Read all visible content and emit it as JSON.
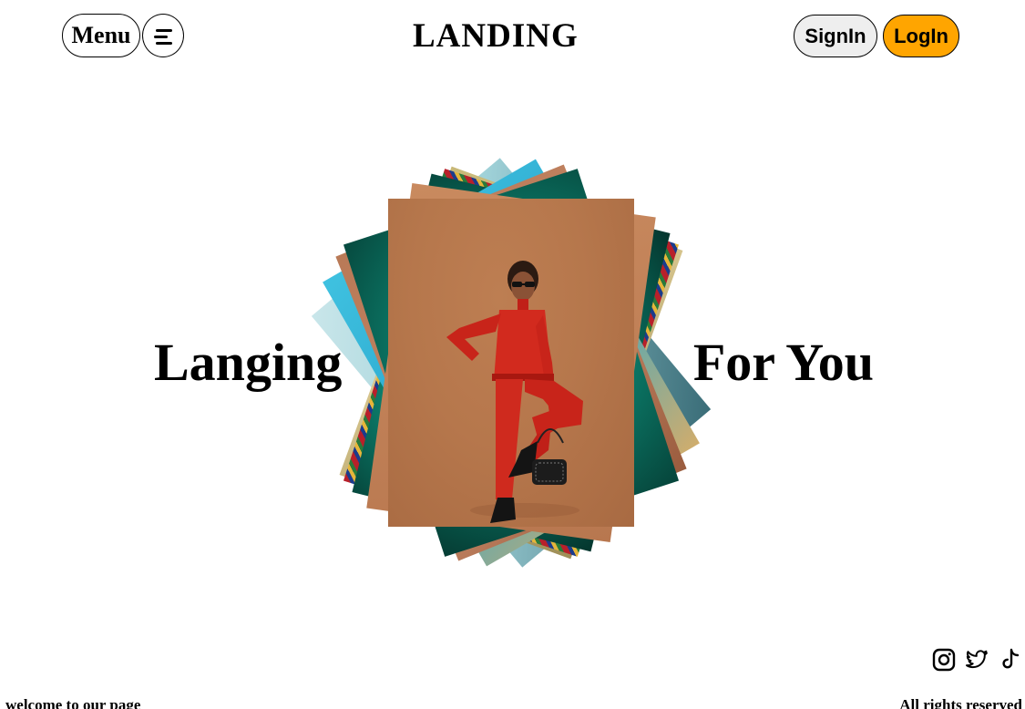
{
  "header": {
    "menu_label": "Menu",
    "menu_icon": "hamburger-icon",
    "logo_text": "LANDING",
    "signin_label": "SignIn",
    "login_label": "LogIn"
  },
  "hero": {
    "headline_left": "Langing",
    "headline_right": "For You"
  },
  "colors": {
    "login_bg": "#ffa500",
    "signin_bg": "#eeeeee",
    "photo_bg": "#b6774c",
    "teal": "#0c7d6b"
  },
  "social": [
    {
      "name": "instagram-icon"
    },
    {
      "name": "twitter-icon"
    },
    {
      "name": "tiktok-icon"
    }
  ],
  "footer": {
    "left_text": "welcome to our page",
    "right_text": "All rights reserved"
  }
}
